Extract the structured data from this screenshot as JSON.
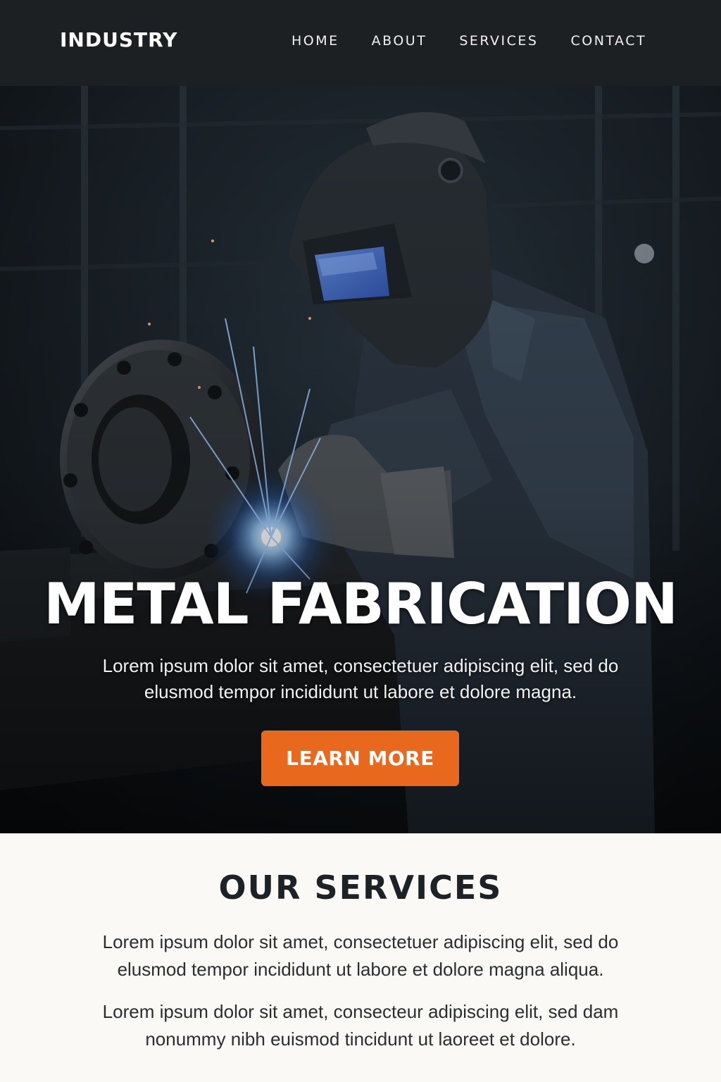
{
  "header": {
    "logo": "INDUSTRY",
    "nav": [
      "HOME",
      "ABOUT",
      "SERVICES",
      "CONTACT"
    ]
  },
  "hero": {
    "title": "METAL FABRICATION",
    "subtitle": "Lorem ipsum dolor sit amet, consectetuer adipiscing elit, sed do elusmod tempor incididunt ut labore et dolore magna.",
    "cta_label": "LEARN MORE",
    "image_subject": "welder-at-work"
  },
  "services": {
    "title": "OUR SERVICES",
    "paragraphs": [
      "Lorem ipsum dolor sit amet, consectetuer adipiscing elit, sed do elusmod tempor incididunt ut labore et dolore magna aliqua.",
      "Lorem ipsum dolor sit amet, consecteur adipiscing elit, sed dam nonummy nibh euismod tincidunt ut laoreet et dolore."
    ]
  },
  "colors": {
    "header_bg": "#1c2023",
    "accent": "#e8681e",
    "page_bg": "#faf9f5",
    "text_dark": "#1d2226"
  }
}
